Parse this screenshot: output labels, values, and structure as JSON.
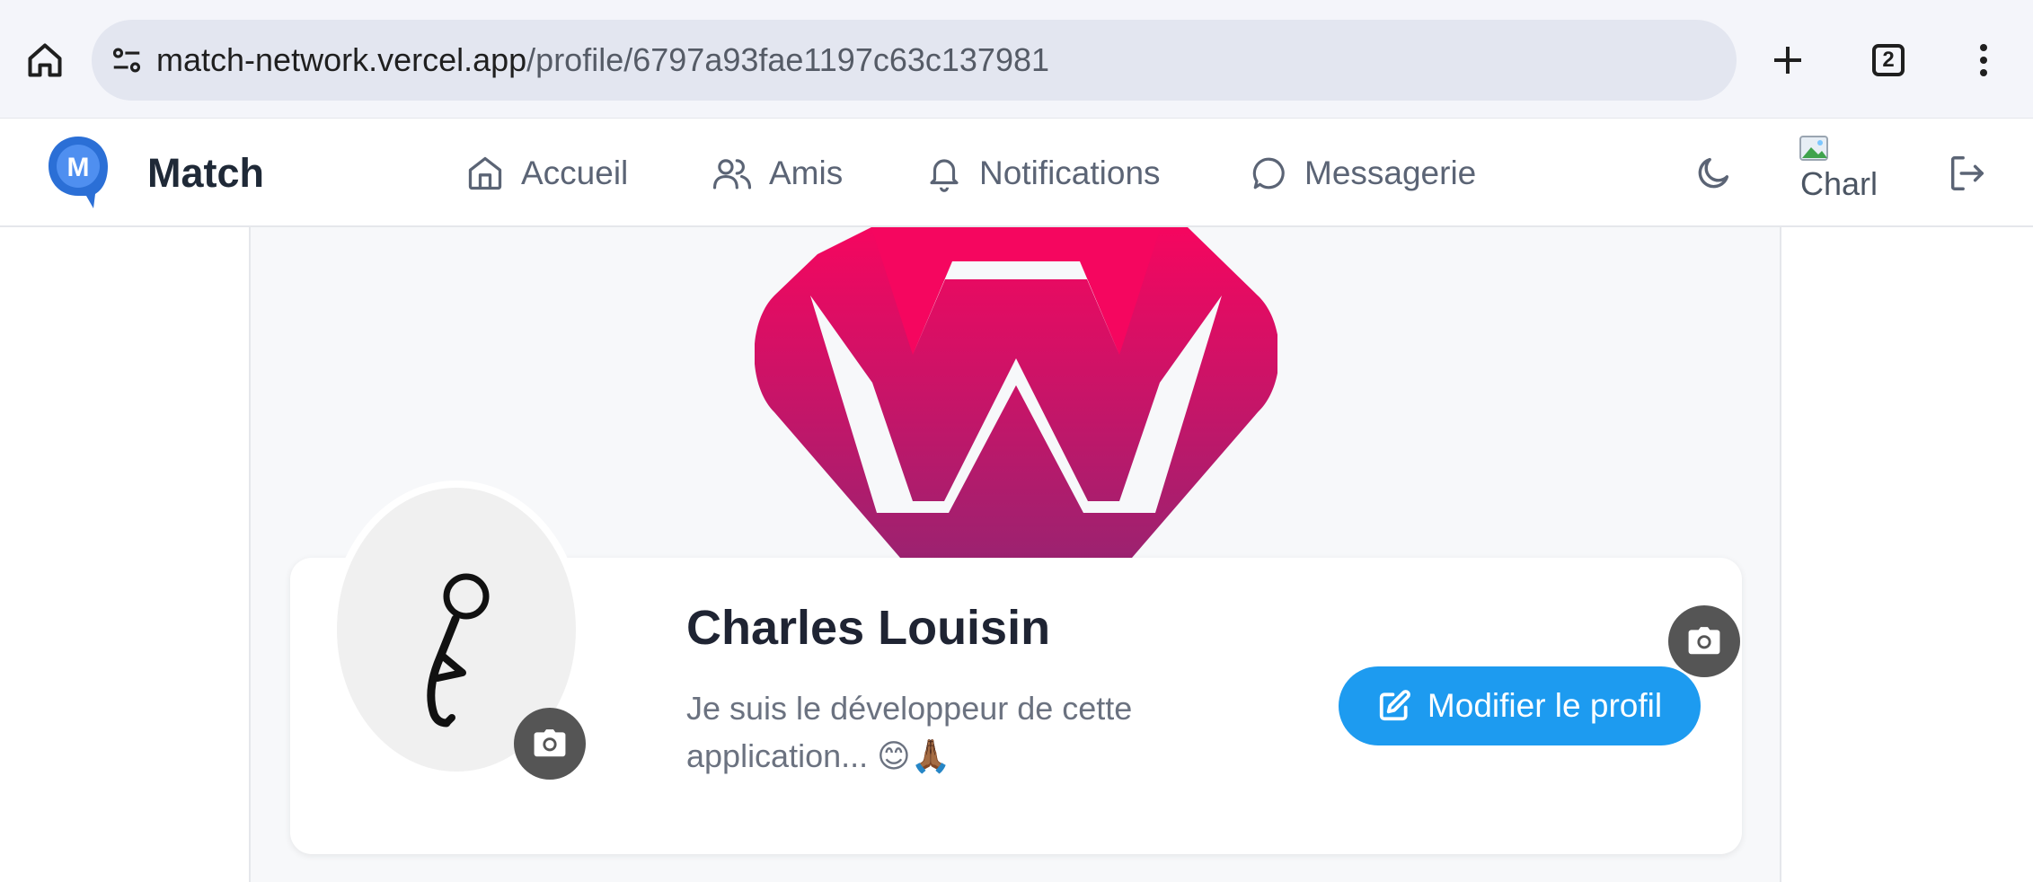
{
  "browser": {
    "url_host": "match-network.vercel.app",
    "url_path": "/profile/6797a93fae1197c63c137981",
    "tab_count": "2",
    "icons": [
      "home-icon",
      "site-settings-icon",
      "new-tab-icon",
      "tabs-icon",
      "more-menu-icon"
    ]
  },
  "header": {
    "brand": "Match",
    "logo_letter": "M",
    "nav": [
      {
        "label": "Accueil",
        "icon": "home-icon"
      },
      {
        "label": "Amis",
        "icon": "friends-icon"
      },
      {
        "label": "Notifications",
        "icon": "bell-icon"
      },
      {
        "label": "Messagerie",
        "icon": "message-icon"
      }
    ],
    "avatar_alt": "Charl",
    "icons": [
      "moon-icon",
      "logout-icon"
    ]
  },
  "profile": {
    "name": "Charles Louisin",
    "bio": "Je suis le développeur de cette application... 😊🙏🏾",
    "edit_button": "Modifier le profil"
  },
  "colors": {
    "accent": "#1d9bf0",
    "cover_top": "#f5065f",
    "cover_bottom": "#9c2270",
    "logo_blue": "#2b6fd6"
  }
}
